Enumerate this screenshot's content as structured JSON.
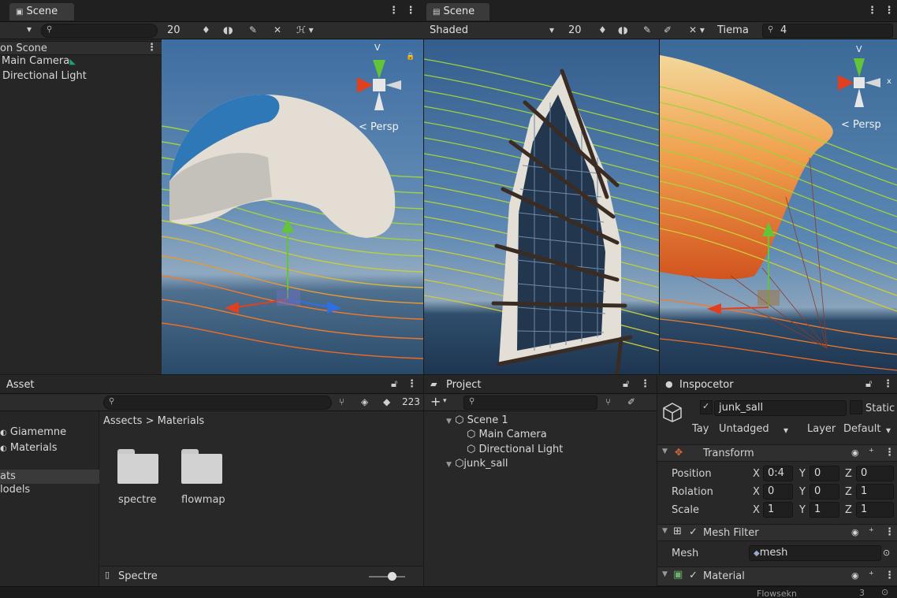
{
  "scene_left": {
    "tab_title": "Scene",
    "toolbar_value": "20",
    "hierarchy": {
      "scene_label": "on Scone",
      "items": [
        "Main Camera",
        "Directional Light"
      ]
    },
    "gizmo_axis": "V",
    "persp_label": "< Persp"
  },
  "scene_right": {
    "tab_title": "Scene",
    "shading_mode": "Shaded",
    "toolbar_value": "20",
    "tiema_label": "Tiema",
    "search_value": "4",
    "gizmo_axis": "V",
    "gizmo_x": "x",
    "persp_label": "< Persp"
  },
  "asset_panel": {
    "title": "Asset",
    "count": "223",
    "breadcrumb": "Assects > Materials",
    "tree": [
      "Giamemne",
      "Materials",
      "ats",
      "lodels"
    ],
    "folders": [
      "spectre",
      "flowmap"
    ],
    "footer_label": "Spectre"
  },
  "project_panel": {
    "title": "Project",
    "add_label": "+",
    "tree": [
      {
        "label": "Scene 1",
        "level": 1
      },
      {
        "label": "Main Camera",
        "level": 2
      },
      {
        "label": "Directional Light",
        "level": 2
      },
      {
        "label": "junk_sall",
        "level": 1
      }
    ]
  },
  "inspector": {
    "title": "Inspocetor",
    "object_name": "junk_sall",
    "static_label": "Static",
    "tag_label": "Tay",
    "tag_value": "Untadged",
    "layer_label": "Layer",
    "layer_value": "Default",
    "transform_title": "Transform",
    "position_label": "Position",
    "rotation_label": "Rolation",
    "scale_label": "Scale",
    "axis_x": "X",
    "axis_y": "Y",
    "axis_z": "Z",
    "position": {
      "x": "0:4",
      "y": "0",
      "z": "0"
    },
    "rotation": {
      "x": "0",
      "y": "0",
      "z": "1"
    },
    "scale": {
      "x": "1",
      "y": "1",
      "z": "1"
    },
    "mesh_filter_title": "Mesh Filter",
    "mesh_label": "Mesh",
    "mesh_value": "mesh",
    "material_title": "Material"
  },
  "status_bar": {
    "text": "Flowsekn",
    "count": "3"
  },
  "colors": {
    "streamline_green": "#9fd23c",
    "streamline_orange": "#f07a2a",
    "gizmo_red": "#e0401f",
    "gizmo_green": "#63c43a",
    "gizmo_blue": "#2f6fe0"
  }
}
